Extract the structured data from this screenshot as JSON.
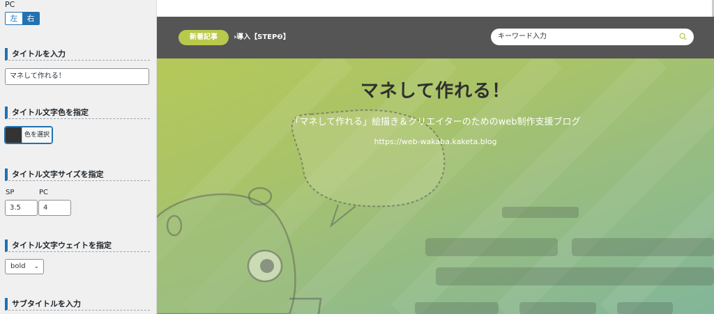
{
  "panel": {
    "pc_label": "PC",
    "align_left": "左",
    "align_right": "右",
    "title_section": "タイトルを入力",
    "title_value": "マネして作れる！",
    "color_section": "タイトル文字色を指定",
    "color_button": "色を選択",
    "color_value": "#333333",
    "size_section": "タイトル文字サイズを指定",
    "sp_label": "SP",
    "pc_size_label": "PC",
    "sp_value": "3.5",
    "pc_value": "4",
    "weight_section": "タイトル文字ウェイトを指定",
    "weight_value": "bold",
    "subtitle_section": "サブタイトルを入力"
  },
  "preview": {
    "news_label": "新着記事",
    "ticker_text": "›導入【STEP❷】",
    "search_placeholder": "キーワード入力",
    "site_title": "マネして作れる！",
    "site_subtitle": "「マネして作れる」絵描き＆クリエイターのためのweb制作支援ブログ",
    "site_url": "https://web-wakaba.kaketa.blog"
  },
  "colors": {
    "accent": "#2271b1",
    "pill": "#b9c94b",
    "navbar": "#555555"
  }
}
